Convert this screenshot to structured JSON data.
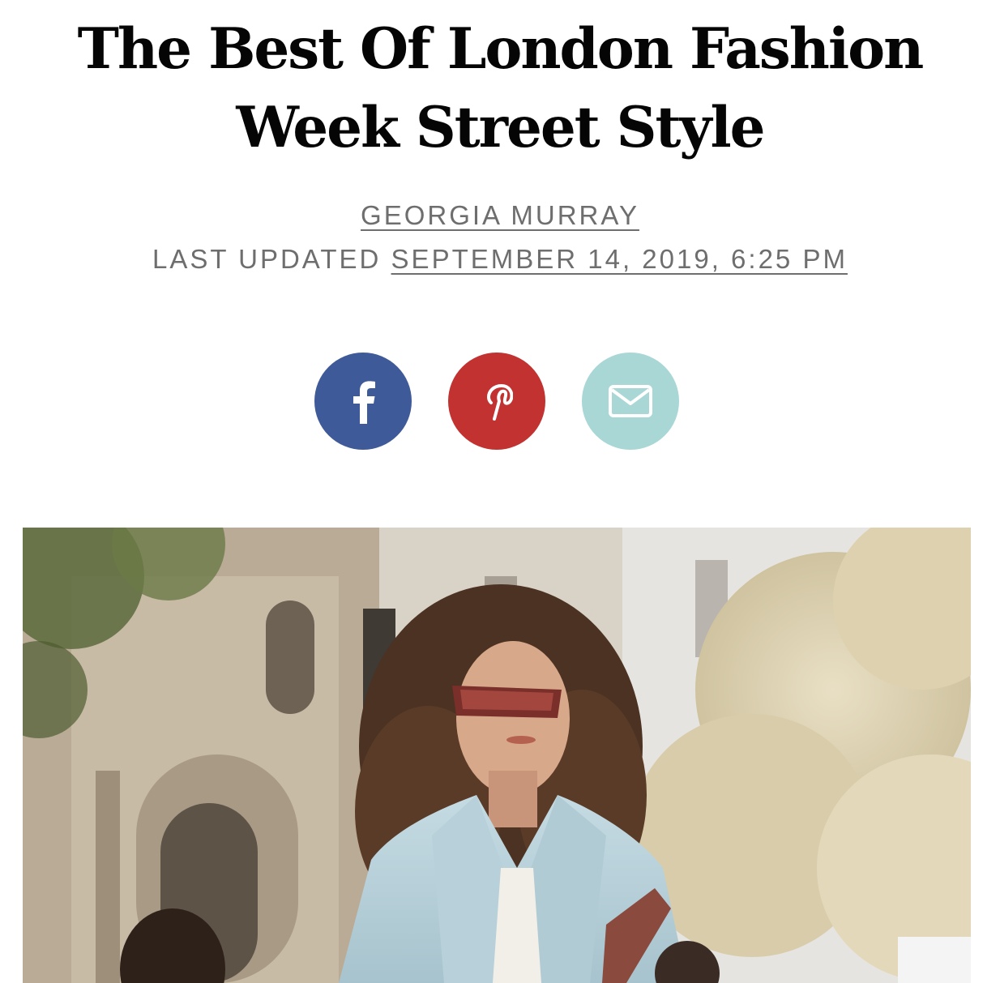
{
  "article": {
    "title": "The Best Of London Fashion Week Street Style",
    "author": "GEORGIA MURRAY",
    "updated_label": "LAST UPDATED",
    "updated_date": "SEPTEMBER 14, 2019, 6:25 PM"
  },
  "share": {
    "buttons": [
      {
        "network": "facebook",
        "icon": "facebook-icon",
        "color": "#3f5a98"
      },
      {
        "network": "pinterest",
        "icon": "pinterest-icon",
        "color": "#c23230"
      },
      {
        "network": "email",
        "icon": "mail-icon",
        "color": "#a8d7d6"
      }
    ]
  },
  "hero_image": {
    "subject": "street-style-photo"
  }
}
